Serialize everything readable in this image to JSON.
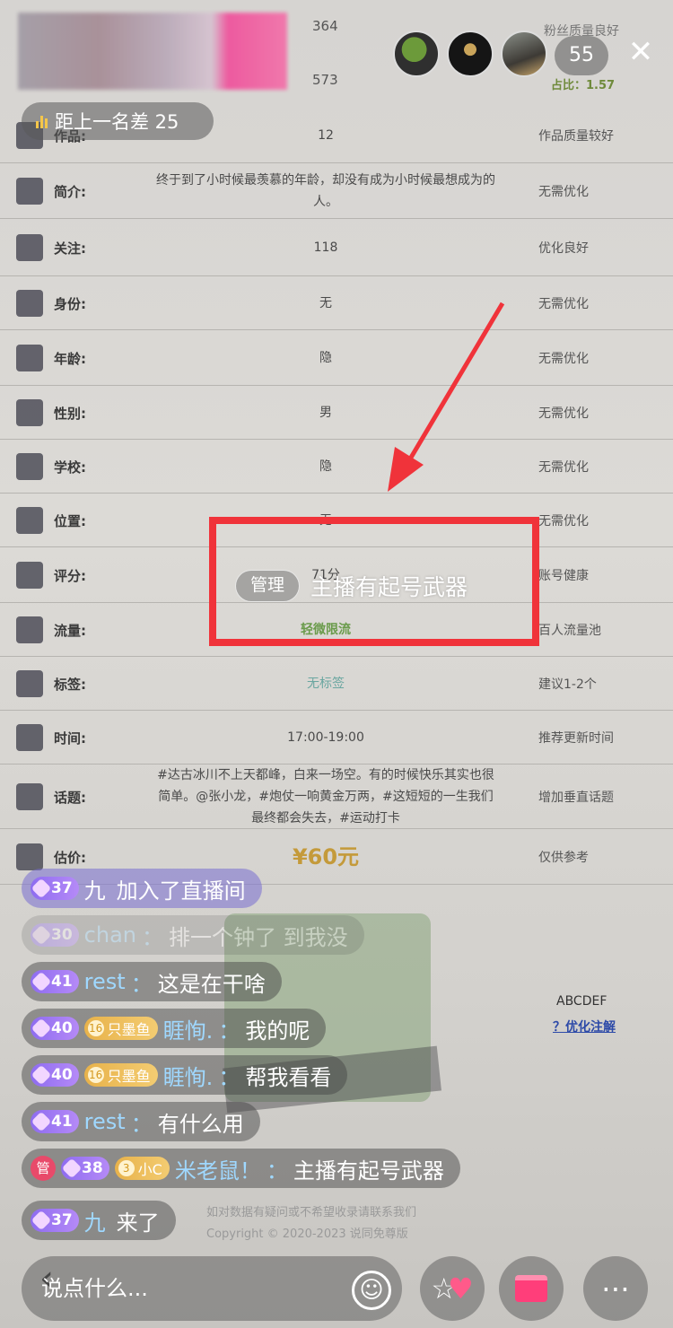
{
  "document": {
    "top_values": [
      "364",
      "573"
    ],
    "top_right": "粉丝质量良好",
    "ratio": "占比：1.57",
    "rows": [
      {
        "label": "作品:",
        "value": "12",
        "advice": "作品质量较好",
        "style": ""
      },
      {
        "label": "简介:",
        "value": "终于到了小时候最羡慕的年龄，却没有成为小时候最想成为的人。",
        "advice": "无需优化",
        "style": ""
      },
      {
        "label": "关注:",
        "value": "118",
        "advice": "优化良好",
        "style": ""
      },
      {
        "label": "身份:",
        "value": "无",
        "advice": "无需优化",
        "style": ""
      },
      {
        "label": "年龄:",
        "value": "隐",
        "advice": "无需优化",
        "style": ""
      },
      {
        "label": "性别:",
        "value": "男",
        "advice": "无需优化",
        "style": ""
      },
      {
        "label": "学校:",
        "value": "隐",
        "advice": "无需优化",
        "style": ""
      },
      {
        "label": "位置:",
        "value": "无",
        "advice": "无需优化",
        "style": ""
      },
      {
        "label": "评分:",
        "value": "71分",
        "advice": "账号健康",
        "style": ""
      },
      {
        "label": "流量:",
        "value": "轻微限流",
        "advice": "百人流量池",
        "style": "green"
      },
      {
        "label": "标签:",
        "value": "无标签",
        "advice": "建议1-2个",
        "style": "cyan"
      },
      {
        "label": "时间:",
        "value": "17:00-19:00",
        "advice": "推荐更新时间",
        "style": ""
      },
      {
        "label": "话题:",
        "value": "#达古冰川不上天都峰，白来一场空。有的时候快乐其实也很简单。@张小龙，#炮仗一响黄金万两，#这短短的一生我们最终都会失去，#运动打卡",
        "advice": "增加垂直话题",
        "style": ""
      },
      {
        "label": "估价:",
        "value": "¥60元",
        "advice": "仅供参考",
        "style": "price"
      }
    ],
    "side_text": "ABCDEF",
    "side_link": "？优化注解",
    "copyright_line1": "如对数据有疑问或不希望收录请联系我们",
    "copyright_line2": "Copyright © 2020-2023 说同免尊版"
  },
  "overlay": {
    "rank_text": "距上一名差 25",
    "viewer_count": "55",
    "close_label": "✕",
    "pinned_tag": "管理",
    "pinned_text": "主播有起号武器"
  },
  "chat": [
    {
      "level": "37",
      "fan": "",
      "fan_level": "",
      "manager": false,
      "user": "九",
      "sep": " ",
      "text": "加入了直播间",
      "type": "join"
    },
    {
      "level": "30",
      "fan": "",
      "fan_level": "",
      "manager": false,
      "user": "chan",
      "sep": "：",
      "text": "排一个钟了 到我没",
      "type": "fade"
    },
    {
      "level": "41",
      "fan": "",
      "fan_level": "",
      "manager": false,
      "user": "rest",
      "sep": "：",
      "text": "这是在干啥",
      "type": ""
    },
    {
      "level": "40",
      "fan": "只墨鱼",
      "fan_level": "16",
      "manager": false,
      "user": "睚恂.",
      "sep": "：",
      "text": "我的呢",
      "type": ""
    },
    {
      "level": "40",
      "fan": "只墨鱼",
      "fan_level": "16",
      "manager": false,
      "user": "睚恂.",
      "sep": "：",
      "text": "帮我看看",
      "type": ""
    },
    {
      "level": "41",
      "fan": "",
      "fan_level": "",
      "manager": false,
      "user": "rest",
      "sep": "：",
      "text": "有什么用",
      "type": ""
    },
    {
      "level": "38",
      "fan": "小C",
      "fan_level": "3",
      "manager": true,
      "user": "米老鼠！",
      "sep": "：",
      "text": "主播有起号武器",
      "type": ""
    },
    {
      "level": "37",
      "fan": "",
      "fan_level": "",
      "manager": false,
      "user": "九",
      "sep": " ",
      "text": "来了",
      "type": ""
    }
  ],
  "manager_badge": "管",
  "bottom": {
    "input_placeholder": "说点什么...",
    "emoji_glyph": "☺"
  },
  "icons": [
    "bar-chart-icon",
    "close-icon",
    "emoji-icon",
    "star-heart-icon",
    "gift-icon",
    "more-icon",
    "back-icon"
  ],
  "colors": {
    "accent_red": "#f0333a",
    "level_purple": "#8e6cf0",
    "fan_gold": "#e8b24a",
    "manager_red": "#e84a6a"
  }
}
